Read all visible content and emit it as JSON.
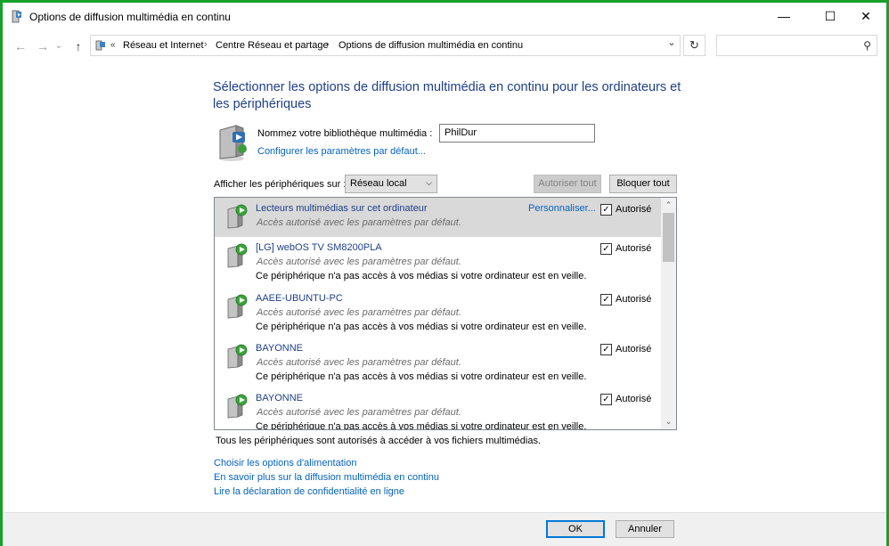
{
  "window": {
    "title": "Options de diffusion multimédia en continu",
    "minimize": "—",
    "maximize": "☐",
    "close": "✕"
  },
  "nav": {
    "back": "←",
    "forward": "→",
    "recent": "⌄",
    "up": "↑",
    "breadcrumb_prefix": "«",
    "breadcrumb": [
      "Réseau et Internet",
      "Centre Réseau et partage",
      "Options de diffusion multimédia en continu"
    ],
    "separator": "›",
    "dropdown": "⌄",
    "refresh": "↻",
    "search_placeholder": "",
    "search_glyph": "⚲"
  },
  "main": {
    "heading": "Sélectionner les options de diffusion multimédia en continu pour les ordinateurs et les périphériques",
    "library_label": "Nommez votre bibliothèque multimédia :",
    "library_value": "PhilDur",
    "config_link": "Configurer les paramètres par défaut...",
    "show_label": "Afficher les périphériques sur :",
    "network_select": "Réseau local",
    "select_glyph": "⌵",
    "allow_all": "Autoriser tout",
    "block_all": "Bloquer tout"
  },
  "devices": [
    {
      "name": "Lecteurs multimédias sur cet ordinateur",
      "desc": "Accès autorisé avec les paramètres par défaut.",
      "warn": "",
      "customize": "Personnaliser...",
      "checked": "✓",
      "status": "Autorisé"
    },
    {
      "name": "[LG] webOS TV SM8200PLA",
      "desc": "Accès autorisé avec les paramètres par défaut.",
      "warn": "Ce périphérique n'a pas accès à vos médias si votre ordinateur est en veille.",
      "checked": "✓",
      "status": "Autorisé"
    },
    {
      "name": "AAEE-UBUNTU-PC",
      "desc": "Accès autorisé avec les paramètres par défaut.",
      "warn": "Ce périphérique n'a pas accès à vos médias si votre ordinateur est en veille.",
      "checked": "✓",
      "status": "Autorisé"
    },
    {
      "name": "BAYONNE",
      "desc": "Accès autorisé avec les paramètres par défaut.",
      "warn": "Ce périphérique n'a pas accès à vos médias si votre ordinateur est en veille.",
      "checked": "✓",
      "status": "Autorisé"
    },
    {
      "name": "BAYONNE",
      "desc": "Accès autorisé avec les paramètres par défaut.",
      "warn": "Ce périphérique n'a pas accès à vos médias si votre ordinateur est en veille.",
      "checked": "✓",
      "status": "Autorisé"
    }
  ],
  "scroll": {
    "up": "⌃",
    "down": "⌄"
  },
  "summary": "Tous les périphériques sont autorisés à accéder à vos fichiers multimédias.",
  "links": [
    "Choisir les options d'alimentation",
    "En savoir plus sur la diffusion multimédia en continu",
    "Lire la déclaration de confidentialité en ligne"
  ],
  "footer": {
    "ok": "OK",
    "cancel": "Annuler"
  },
  "colors": {
    "frame": "#17a12a",
    "heading": "#1e3f8a",
    "link": "#0563c1",
    "accent": "#0078d7"
  }
}
